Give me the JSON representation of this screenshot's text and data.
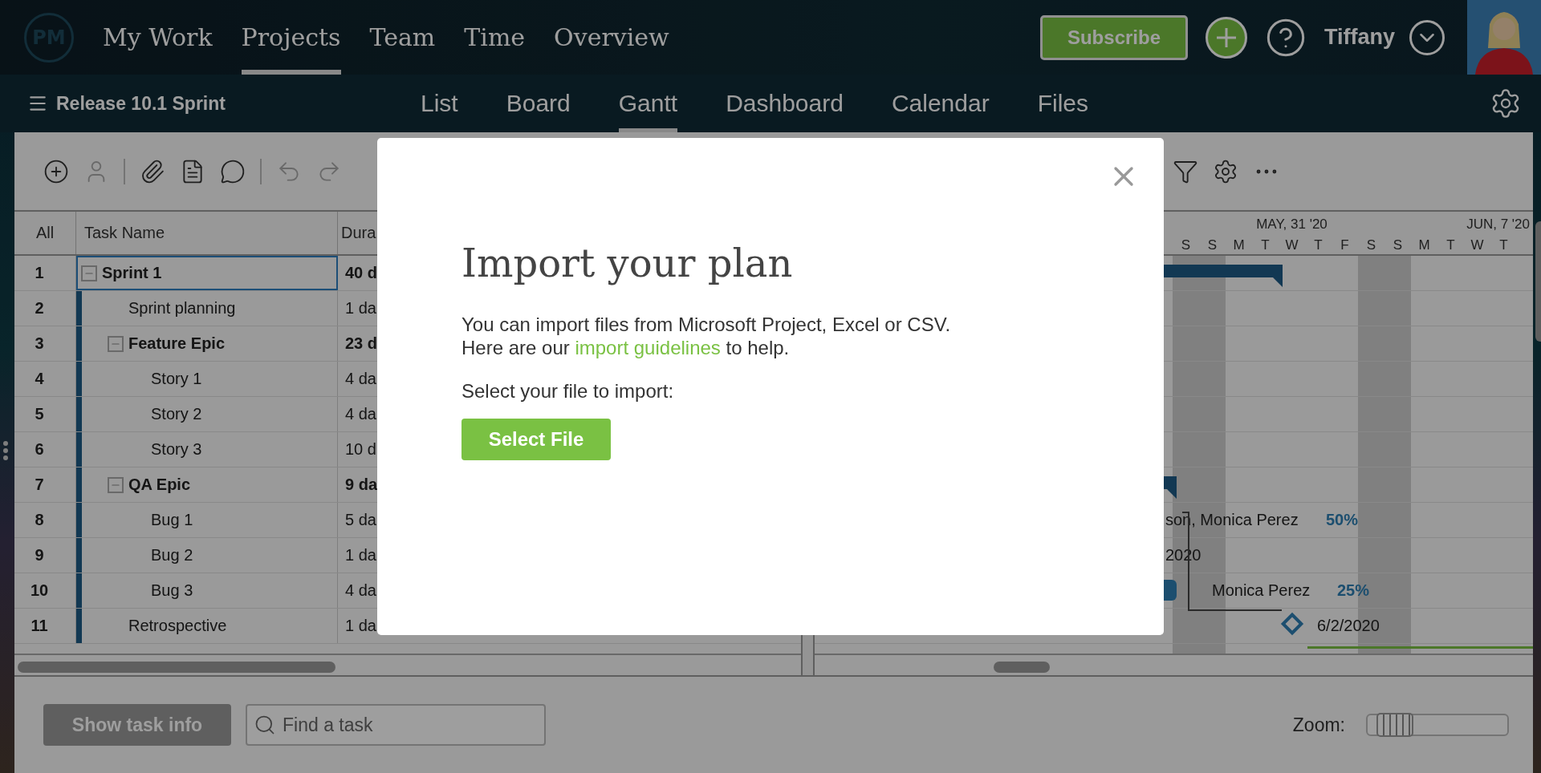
{
  "top_nav": {
    "logo": "PM",
    "items": [
      {
        "label": "My Work",
        "selected": false
      },
      {
        "label": "Projects",
        "selected": true
      },
      {
        "label": "Team",
        "selected": false
      },
      {
        "label": "Time",
        "selected": false
      },
      {
        "label": "Overview",
        "selected": false
      }
    ]
  },
  "header_actions": {
    "subscribe": "Subscribe",
    "user": "Tiffany"
  },
  "project": {
    "title": "Release 10.1 Sprint"
  },
  "view_tabs": [
    {
      "label": "List",
      "selected": false
    },
    {
      "label": "Board",
      "selected": false
    },
    {
      "label": "Gantt",
      "selected": true
    },
    {
      "label": "Dashboard",
      "selected": false
    },
    {
      "label": "Calendar",
      "selected": false
    },
    {
      "label": "Files",
      "selected": false
    }
  ],
  "toolbar": {
    "left": [
      {
        "kind": "add",
        "disabled": false
      },
      {
        "kind": "assign",
        "disabled": true
      },
      {
        "kind": "separator"
      },
      {
        "kind": "attach",
        "disabled": false
      },
      {
        "kind": "notes",
        "disabled": false
      },
      {
        "kind": "comment",
        "disabled": false
      },
      {
        "kind": "separator"
      },
      {
        "kind": "undo",
        "disabled": true
      },
      {
        "kind": "redo",
        "disabled": true
      }
    ],
    "right": [
      {
        "kind": "filter",
        "disabled": false
      },
      {
        "kind": "settings",
        "disabled": false
      },
      {
        "kind": "more",
        "disabled": false
      }
    ]
  },
  "table": {
    "columns": [
      "All",
      "Task Name",
      "Dura"
    ],
    "rows": [
      {
        "number": "1",
        "name": "Sprint 1",
        "duration": "40 d",
        "kind": "summary",
        "expanded": true,
        "selected": true,
        "children": [
          {
            "number": "2",
            "name": "Sprint planning",
            "duration": "1 da",
            "kind": "task",
            "selected": false
          },
          {
            "number": "3",
            "name": "Feature Epic",
            "duration": "23 d",
            "kind": "summary",
            "expanded": true,
            "selected": false,
            "children": [
              {
                "number": "4",
                "name": "Story 1",
                "duration": "4 da",
                "kind": "task",
                "selected": false
              },
              {
                "number": "5",
                "name": "Story 2",
                "duration": "4 da",
                "kind": "task",
                "selected": false
              },
              {
                "number": "6",
                "name": "Story 3",
                "duration": "10 d",
                "kind": "task",
                "selected": false
              }
            ]
          },
          {
            "number": "7",
            "name": "QA Epic",
            "duration": "9 da",
            "kind": "summary",
            "expanded": true,
            "selected": false,
            "children": [
              {
                "number": "8",
                "name": "Bug 1",
                "duration": "5 da",
                "kind": "task",
                "selected": false
              },
              {
                "number": "9",
                "name": "Bug 2",
                "duration": "1 da",
                "kind": "task",
                "selected": false
              },
              {
                "number": "10",
                "name": "Bug 3",
                "duration": "4 da",
                "kind": "task",
                "selected": false
              }
            ]
          },
          {
            "number": "11",
            "name": "Retrospective",
            "duration": "1 da",
            "kind": "task",
            "selected": false
          }
        ]
      }
    ]
  },
  "gantt": {
    "weeks": [
      "MAY, 31 '20",
      "JUN, 7 '20"
    ],
    "days": [
      {
        "label": "S",
        "weekend": true
      },
      {
        "label": "S",
        "weekend": true
      },
      {
        "label": "M",
        "weekend": false
      },
      {
        "label": "T",
        "weekend": false
      },
      {
        "label": "W",
        "weekend": false
      },
      {
        "label": "T",
        "weekend": false
      },
      {
        "label": "F",
        "weekend": false
      },
      {
        "label": "S",
        "weekend": true
      },
      {
        "label": "S",
        "weekend": true
      },
      {
        "label": "M",
        "weekend": false
      },
      {
        "label": "T",
        "weekend": false
      },
      {
        "label": "W",
        "weekend": false
      },
      {
        "label": "T",
        "weekend": false
      }
    ],
    "labels": [
      {
        "text": "son, Monica Perez",
        "progress": "50%"
      },
      {
        "text": "2020"
      },
      {
        "text": "Monica Perez",
        "progress": "25%"
      },
      {
        "text": "6/2/2020"
      }
    ]
  },
  "footer": {
    "task_info": {
      "label": "Show task info",
      "disabled": true
    },
    "search": {
      "placeholder": "Find a task"
    },
    "zoom": {
      "label": "Zoom:",
      "level": 0.08
    }
  },
  "dialog": {
    "title": "Import your plan",
    "line1": "You can import files from Microsoft Project, Excel or CSV.",
    "line2_before": "Here are our",
    "link": "import guidelines",
    "line2_after": "to help.",
    "prompt": "Select your file to import:",
    "button": "Select File"
  }
}
